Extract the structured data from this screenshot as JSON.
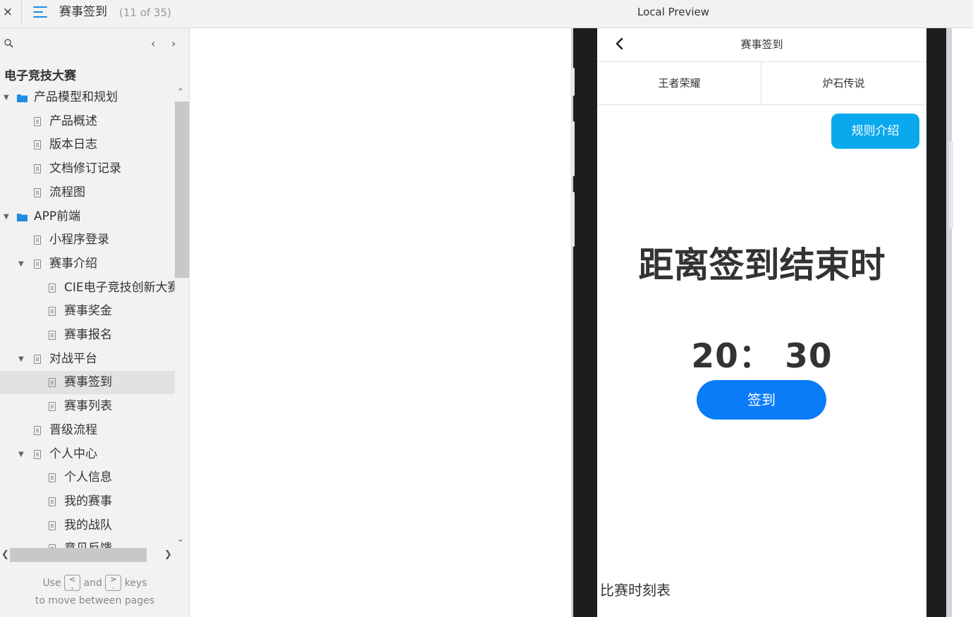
{
  "topbar": {
    "close_label": "×",
    "page_title": "赛事签到",
    "page_count": "(11 of 35)",
    "preview_title": "Local Preview"
  },
  "sidebar": {
    "prev_label": "‹",
    "next_label": "›",
    "project_title": "电子竞技大赛",
    "tree": [
      {
        "label": "产品模型和规划",
        "type": "folder",
        "level": 0,
        "expanded": true
      },
      {
        "label": "产品概述",
        "type": "page",
        "level": 1
      },
      {
        "label": "版本日志",
        "type": "page",
        "level": 1
      },
      {
        "label": "文档修订记录",
        "type": "page",
        "level": 1
      },
      {
        "label": "流程图",
        "type": "page",
        "level": 1
      },
      {
        "label": "APP前端",
        "type": "folder",
        "level": 0,
        "expanded": true
      },
      {
        "label": "小程序登录",
        "type": "page",
        "level": 1
      },
      {
        "label": "赛事介绍",
        "type": "page",
        "level": 1,
        "expanded": true
      },
      {
        "label": "CIE电子竞技创新大赛",
        "type": "page",
        "level": 2
      },
      {
        "label": "赛事奖金",
        "type": "page",
        "level": 2
      },
      {
        "label": "赛事报名",
        "type": "page",
        "level": 2
      },
      {
        "label": "对战平台",
        "type": "page",
        "level": 1,
        "expanded": true
      },
      {
        "label": "赛事签到",
        "type": "page",
        "level": 2,
        "selected": true
      },
      {
        "label": "赛事列表",
        "type": "page",
        "level": 2
      },
      {
        "label": "晋级流程",
        "type": "page",
        "level": 1
      },
      {
        "label": "个人中心",
        "type": "page",
        "level": 1,
        "expanded": true
      },
      {
        "label": "个人信息",
        "type": "page",
        "level": 2
      },
      {
        "label": "我的赛事",
        "type": "page",
        "level": 2
      },
      {
        "label": "我的战队",
        "type": "page",
        "level": 2
      },
      {
        "label": "意见反馈",
        "type": "page",
        "level": 2
      }
    ],
    "hint": {
      "use": "Use",
      "key_prev": "<",
      "key_prev_sub": ",",
      "and": "and",
      "key_next": ">",
      "key_next_sub": ".",
      "keys": "keys",
      "line2": "to move between pages"
    }
  },
  "screen": {
    "title": "赛事签到",
    "tabs": [
      "王者荣耀",
      "炉石传说"
    ],
    "rules_button": "规则介绍",
    "countdown_heading": "距离签到结束时",
    "countdown_time": "20： 30",
    "checkin_button": "签到",
    "schedule_label": "比赛时刻表"
  },
  "colors": {
    "accent_blue": "#1e8ce3",
    "rules_button": "#0aa9ee",
    "checkin_button": "#0a7cf8",
    "phone_frame": "#1d1d1f"
  }
}
